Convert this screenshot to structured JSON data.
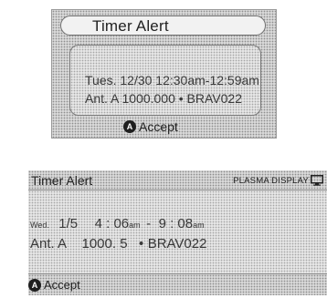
{
  "dialog1": {
    "title": "Timer Alert",
    "line1": "Tues. 12/30 12:30am-12:59am",
    "line2": "Ant. A 1000.000 • BRAV022",
    "accept_badge": "A",
    "accept_label": "Accept"
  },
  "dialog2": {
    "title": "Timer Alert",
    "display_label": "PLASMA DISPLAY",
    "display_icon": "monitor-icon",
    "day": "Wed.",
    "date": "1/5",
    "start_time": "4 : 06",
    "start_suffix": "am",
    "separator": "-",
    "end_time": "9 : 08",
    "end_suffix": "am",
    "antenna": "Ant.  A",
    "channel": "1000. 5",
    "bullet": "•",
    "station": "BRAV022",
    "accept_badge": "A",
    "accept_label": "Accept"
  }
}
